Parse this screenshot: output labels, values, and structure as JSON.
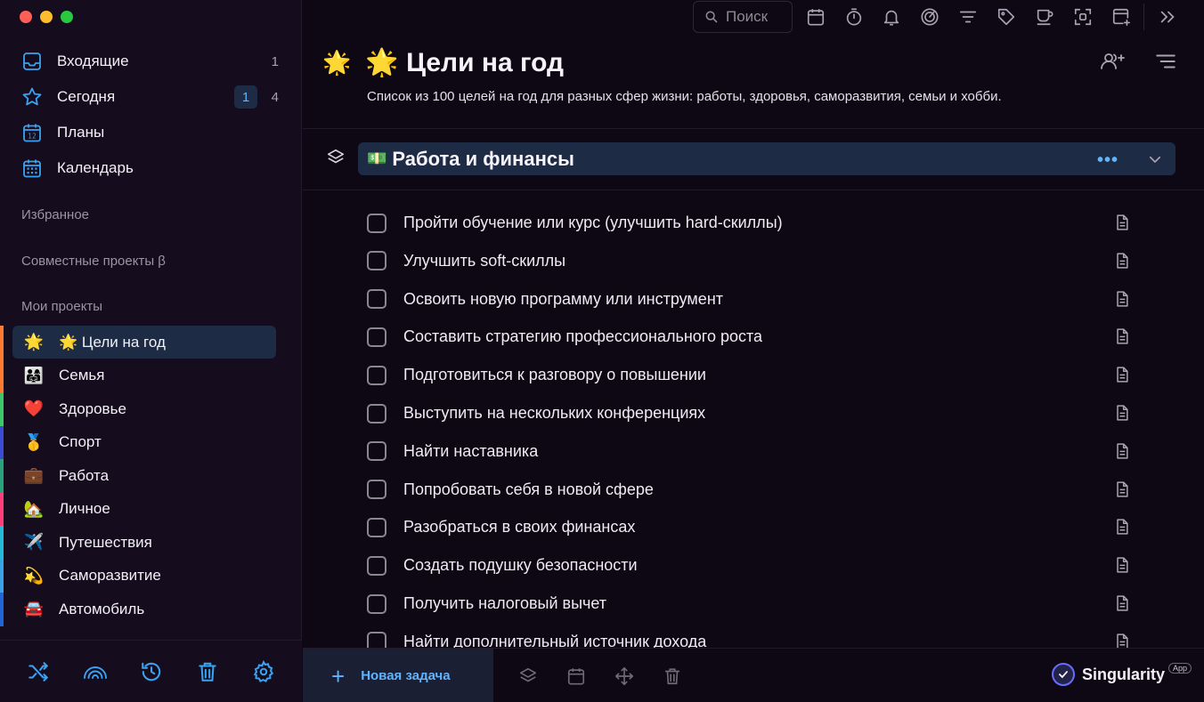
{
  "window": {
    "controls": [
      "close",
      "minimize",
      "maximize"
    ]
  },
  "sidebar": {
    "nav": [
      {
        "label": "Входящие",
        "icon": "inbox-icon",
        "count": "1"
      },
      {
        "label": "Сегодня",
        "icon": "star-icon",
        "count_highlight": "1",
        "count": "4"
      },
      {
        "label": "Планы",
        "icon": "calendar-12-icon"
      },
      {
        "label": "Календарь",
        "icon": "calendar-grid-icon"
      }
    ],
    "favorites_label": "Избранное",
    "shared_label": "Совместные проекты β",
    "my_projects_label": "Мои проекты",
    "projects": [
      {
        "emoji": "🌟",
        "label": "🌟 Цели на год",
        "color": "#ff7a2f",
        "active": true
      },
      {
        "emoji": "👨‍👩‍👧",
        "label": "Семья",
        "color": "#ff7a2f"
      },
      {
        "emoji": "❤️",
        "label": "Здоровье",
        "color": "#3cc86a"
      },
      {
        "emoji": "🥇",
        "label": "Спорт",
        "color": "#3a4bd6"
      },
      {
        "emoji": "💼",
        "label": "Работа",
        "color": "#2aa37d"
      },
      {
        "emoji": "🏡",
        "label": "Личное",
        "color": "#ff3d7a"
      },
      {
        "emoji": "✈️",
        "label": "Путешествия",
        "color": "#26b8d8"
      },
      {
        "emoji": "💫",
        "label": "Саморазвитие",
        "color": "#3aa2e6"
      },
      {
        "emoji": "🚘",
        "label": "Автомобиль",
        "color": "#2166d8"
      }
    ],
    "bottom_icons": [
      "shuffle-icon",
      "rainbow-icon",
      "history-icon",
      "trash-icon",
      "settings-icon"
    ]
  },
  "toolbar": {
    "search_placeholder": "Поиск",
    "icons": [
      "calendar-icon",
      "timer-icon",
      "bell-icon",
      "focus-icon",
      "filter-icon",
      "tag-icon",
      "coffee-icon",
      "scan-icon",
      "add-window-icon",
      "collapse-right-icon"
    ]
  },
  "project": {
    "emoji": "🌟",
    "title": "🌟 Цели на год",
    "description": "Список из 100 целей на год для разных сфер жизни: работы, здоровья, саморазвития, семьи и хобби."
  },
  "group": {
    "emoji": "💵",
    "title": "Работа и финансы",
    "dots": "•••"
  },
  "tasks": [
    "Пройти обучение или курс (улучшить hard-скиллы)",
    "Улучшить soft-скиллы",
    "Освоить новую программу или инструмент",
    "Составить стратегию профессионального роста",
    "Подготовиться к разговору о повышении",
    "Выступить на нескольких конференциях",
    "Найти наставника",
    "Попробовать себя в новой сфере",
    "Разобраться в своих финансах",
    "Создать подушку безопасности",
    "Получить налоговый вычет",
    "Найти дополнительный источник дохода"
  ],
  "bottom": {
    "new_task_label": "Новая задача",
    "plus": "+",
    "brand_name": "Singularity",
    "brand_badge": "App"
  },
  "colors": {
    "accent": "#5fb4ff",
    "highlight_bg": "#1d2b44",
    "bg": "#0e0714",
    "sidebar_bg": "#150c1d"
  }
}
